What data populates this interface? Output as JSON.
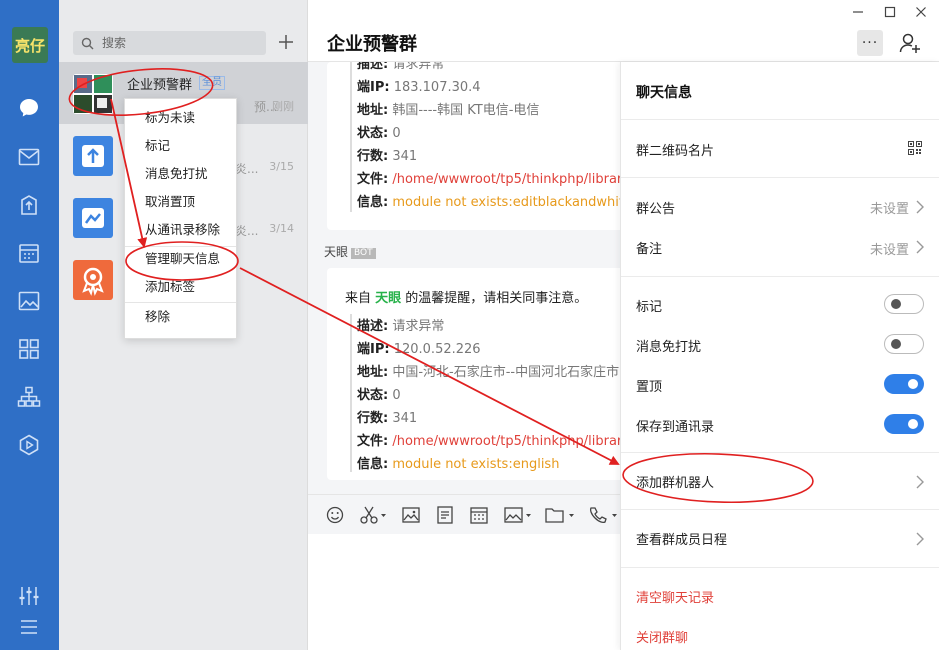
{
  "rail": {
    "avatar_text": "亮仔",
    "icons": [
      "chat-icon",
      "mail-icon",
      "upload-icon",
      "calendar-icon",
      "image-icon",
      "apps-icon",
      "org-chart-icon",
      "play-icon",
      "settings-sliders-icon",
      "menu-icon"
    ]
  },
  "search": {
    "placeholder": "搜索"
  },
  "chats": [
    {
      "name": "企业预警群",
      "badge": "全员",
      "preview": "预...",
      "time": "刚刚"
    },
    {
      "name": "",
      "preview": "炎...",
      "time": "3/15"
    },
    {
      "name": "",
      "preview": "炎...",
      "time": "3/14"
    },
    {
      "name": "",
      "preview": "",
      "time": ""
    }
  ],
  "context_menu": [
    "标为未读",
    "标记",
    "消息免打扰",
    "取消置顶",
    "从通讯录移除",
    "管理聊天信息",
    "添加标签",
    "移除"
  ],
  "header": {
    "title": "企业预警群"
  },
  "messages": {
    "card1": {
      "desc_label": "描述:",
      "desc_value": "请求异常",
      "ip_label": "端IP:",
      "ip_value": "183.107.30.4",
      "addr_label": "地址:",
      "addr_value": "韩国----韩国 KT电信-电信",
      "status_label": "状态:",
      "status_value": "0",
      "lines_label": "行数:",
      "lines_value": "341",
      "file_label": "文件:",
      "file_value": "/home/wwwroot/tp5/thinkphp/librar",
      "info_label": "信息:",
      "info_value": "module not exists:editblackandwhiteli"
    },
    "sender": "天眼",
    "bot_tag": "BOT",
    "card2": {
      "intro_prefix": "来自 ",
      "intro_app": "天眼",
      "intro_suffix": " 的温馨提醒，请相关同事注意。",
      "desc_label": "描述:",
      "desc_value": "请求异常",
      "ip_label": "端IP:",
      "ip_value": "120.0.52.226",
      "addr_label": "地址:",
      "addr_value": "中国-河北-石家庄市--中国河北石家庄市",
      "status_label": "状态:",
      "status_value": "0",
      "lines_label": "行数:",
      "lines_value": "341",
      "file_label": "文件:",
      "file_value": "/home/wwwroot/tp5/thinkphp/librar",
      "info_label": "信息:",
      "info_value": "module not exists:english"
    }
  },
  "drawer": {
    "title": "聊天信息",
    "qr_label": "群二维码名片",
    "notice_label": "群公告",
    "notice_value": "未设置",
    "remark_label": "备注",
    "remark_value": "未设置",
    "mark_label": "标记",
    "dnd_label": "消息免打扰",
    "pin_label": "置顶",
    "save_label": "保存到通讯录",
    "add_bot_label": "添加群机器人",
    "schedule_label": "查看群成员日程",
    "clear_label": "清空聊天记录",
    "close_label": "关闭群聊"
  },
  "colors": {
    "rail": "#2f6fc6",
    "accent": "#2f7fe8",
    "danger": "#e0413a",
    "annotation": "#e02020"
  }
}
